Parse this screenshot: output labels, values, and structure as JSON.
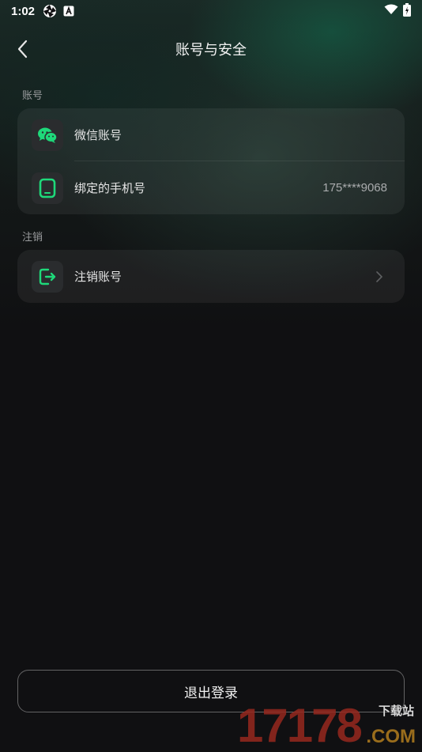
{
  "status_bar": {
    "time": "1:02",
    "icons": [
      "aperture-icon",
      "a-badge-icon",
      "wifi-icon",
      "battery-charging-icon"
    ]
  },
  "header": {
    "back_icon": "chevron-left-icon",
    "title": "账号与安全"
  },
  "sections": {
    "account": {
      "label": "账号",
      "items": [
        {
          "label": "微信账号",
          "icon": "wechat-icon",
          "value": ""
        },
        {
          "label": "绑定的手机号",
          "icon": "phone-icon",
          "value": "175****9068"
        }
      ]
    },
    "cancel": {
      "label": "注销",
      "items": [
        {
          "label": "注销账号",
          "icon": "logout-icon",
          "trailing": "chevron-right-icon"
        }
      ]
    }
  },
  "logout_button": {
    "label": "退出登录"
  },
  "watermark": {
    "number": "17178",
    "site_text": "下载站",
    "suffix": ".COM"
  },
  "colors": {
    "accent": "#1ed97a",
    "background": "#101012",
    "card": "#1d1f20"
  }
}
